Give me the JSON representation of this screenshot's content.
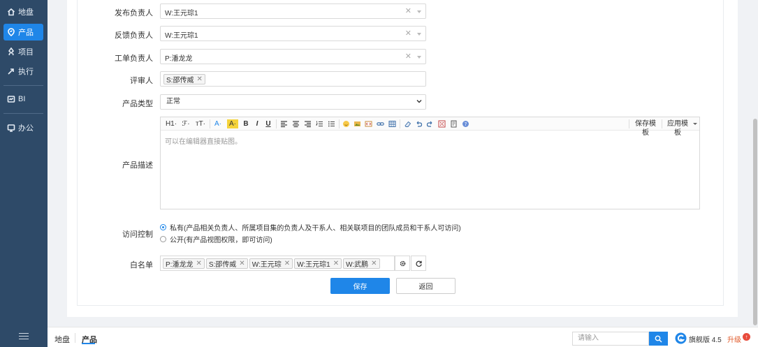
{
  "sidebar": {
    "items": [
      {
        "label": "地盘",
        "icon": "home-icon"
      },
      {
        "label": "产品",
        "icon": "product-icon",
        "active": true
      },
      {
        "label": "项目",
        "icon": "project-icon"
      },
      {
        "label": "执行",
        "icon": "execution-icon"
      },
      {
        "label": "BI",
        "icon": "bi-icon"
      },
      {
        "label": "办公",
        "icon": "office-icon"
      }
    ]
  },
  "form": {
    "release_owner": {
      "label": "发布负责人",
      "value": "W:王元琮1"
    },
    "feedback_owner": {
      "label": "反馈负责人",
      "value": "W:王元琮1"
    },
    "ticket_owner": {
      "label": "工单负责人",
      "value": "P:潘龙龙"
    },
    "reviewer": {
      "label": "评审人",
      "tags": [
        "S:邵传威"
      ]
    },
    "product_type": {
      "label": "产品类型",
      "value": "正常"
    },
    "description": {
      "label": "产品描述",
      "placeholder": "可以在编辑器直接贴图。",
      "toolbar": {
        "heading": "H1·",
        "font": "ℱ·",
        "size": "тT·",
        "font_color": "A·",
        "bg_color": "A·",
        "bold": "B",
        "italic": "I",
        "underline": "U",
        "save_template": "保存模板",
        "apply_template": "应用模板"
      }
    },
    "access_control": {
      "label": "访问控制",
      "options": [
        {
          "label": "私有(产品相关负责人、所属项目集的负责人及干系人、相关联项目的团队成员和干系人可访问)",
          "checked": true
        },
        {
          "label": "公开(有产品视图权限，即可访问)",
          "checked": false
        }
      ]
    },
    "whitelist": {
      "label": "白名单",
      "tags": [
        "P:潘龙龙",
        "S:邵传威",
        "W:王元琮",
        "W:王元琮1",
        "W:武鹏"
      ]
    },
    "save_label": "保存",
    "back_label": "返回"
  },
  "bottombar": {
    "tabs": [
      {
        "label": "地盘"
      },
      {
        "label": "产品",
        "active": true
      }
    ],
    "search_placeholder": "请输入",
    "edition": "旗舰版 4.5",
    "upgrade": "升级"
  },
  "colors": {
    "sidebar_bg": "#2e4a68",
    "accent": "#1f86e8",
    "upgrade": "#e05a2a"
  }
}
